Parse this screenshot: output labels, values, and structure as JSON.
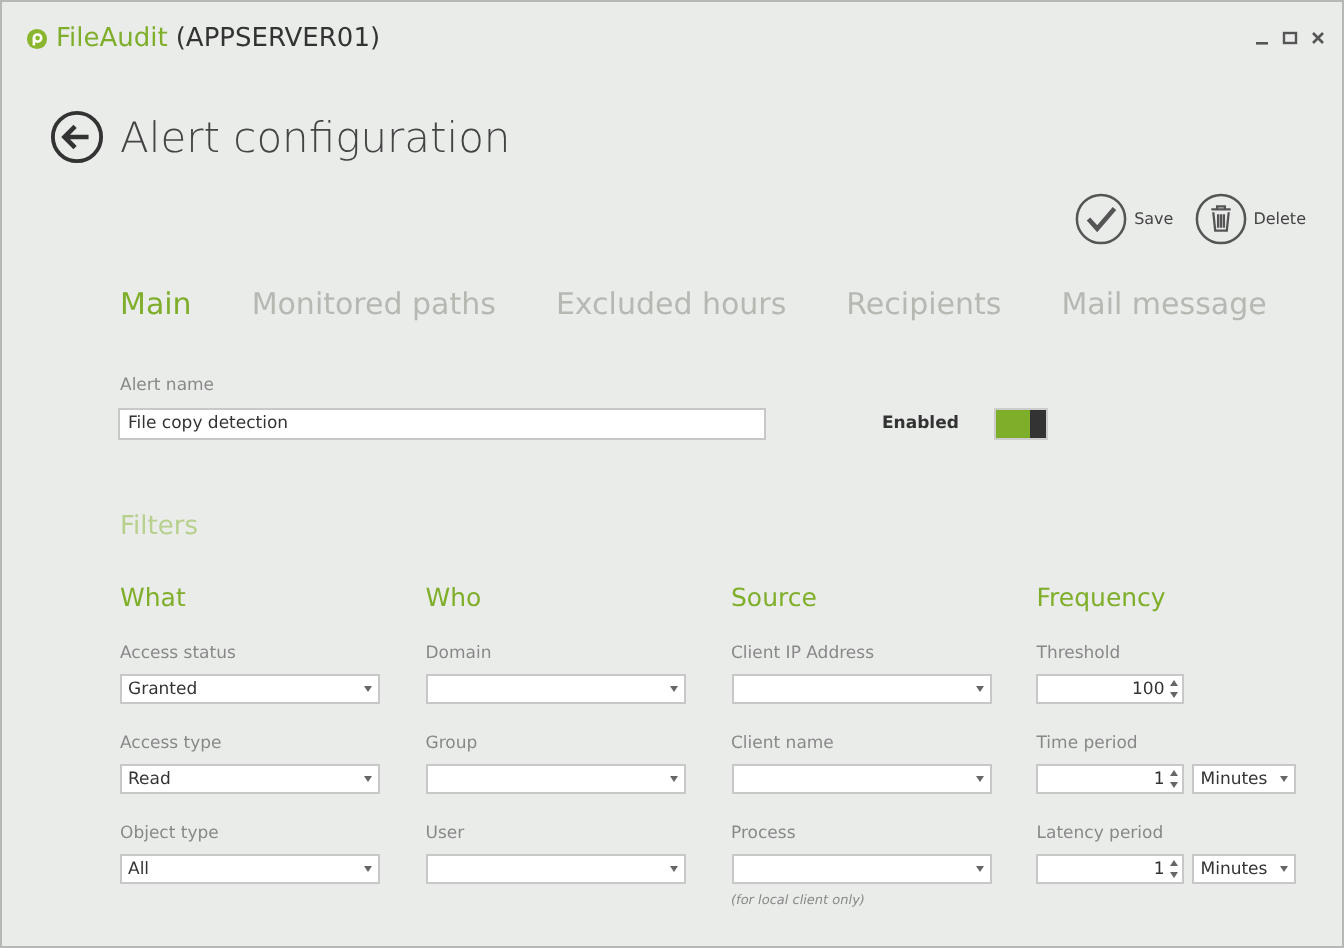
{
  "window": {
    "app_name": "FileAudit",
    "server": "(APPSERVER01)"
  },
  "header": {
    "title": "Alert configuration"
  },
  "actions": [
    {
      "label": "Save",
      "kind": "save"
    },
    {
      "label": "Delete",
      "kind": "delete"
    }
  ],
  "tabs": [
    {
      "label": "Main",
      "selected": true
    },
    {
      "label": "Monitored paths",
      "selected": false
    },
    {
      "label": "Excluded hours",
      "selected": false
    },
    {
      "label": "Recipients",
      "selected": false
    },
    {
      "label": "Mail message",
      "selected": false
    }
  ],
  "alert_name": {
    "label": "Alert name",
    "value": "File copy detection"
  },
  "enabled": {
    "label": "Enabled",
    "on": true
  },
  "filters": {
    "title": "Filters",
    "columns": [
      {
        "title": "What",
        "fields": [
          {
            "label": "Access status",
            "kind": "select",
            "value": "Granted"
          },
          {
            "label": "Access type",
            "kind": "select",
            "value": "Read"
          },
          {
            "label": "Object type",
            "kind": "select",
            "value": "All"
          }
        ]
      },
      {
        "title": "Who",
        "fields": [
          {
            "label": "Domain",
            "kind": "select"
          },
          {
            "label": "Group",
            "kind": "select"
          },
          {
            "label": "User",
            "kind": "select"
          }
        ]
      },
      {
        "title": "Source",
        "fields": [
          {
            "label": "Client IP Address",
            "kind": "select"
          },
          {
            "label": "Client name",
            "kind": "select"
          },
          {
            "label": "Process",
            "kind": "select",
            "hint": "(for local client only)"
          }
        ]
      },
      {
        "title": "Frequency",
        "fields": [
          {
            "label": "Threshold",
            "kind": "spin",
            "value": "100"
          },
          {
            "label": "Time period",
            "kind": "spin",
            "value": "1",
            "unit": "Minutes"
          },
          {
            "label": "Latency period",
            "kind": "spin",
            "value": "1",
            "unit": "Minutes"
          }
        ]
      }
    ]
  }
}
